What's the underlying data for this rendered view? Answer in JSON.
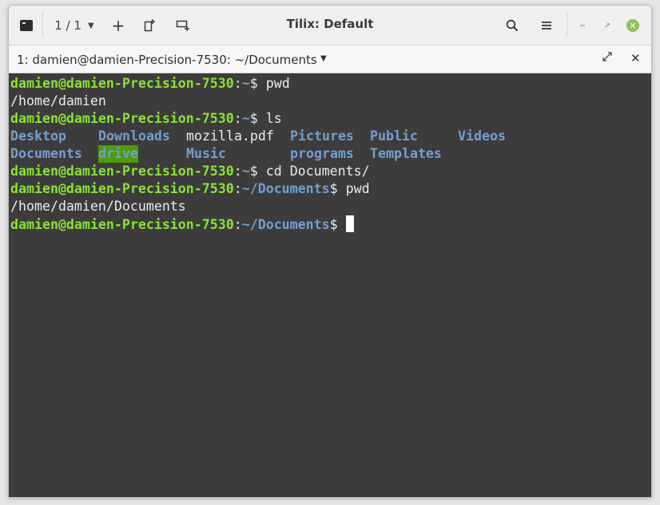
{
  "window": {
    "title": "Tilix: Default",
    "session_label": "1 / 1",
    "icons": {
      "app": "terminal-icon",
      "session_caret": "chevron-down-icon",
      "add_session": "plus-icon",
      "add_terminal_down": "add-terminal-down-icon",
      "add_terminal_right": "add-terminal-right-icon",
      "search": "search-icon",
      "menu": "hamburger-menu-icon",
      "minimize": "minimize-icon",
      "maximize": "maximize-icon",
      "close": "close-icon"
    }
  },
  "tab": {
    "title": "1: damien@damien-Precision-7530: ~/Documents",
    "icons": {
      "caret": "chevron-down-icon",
      "maximize": "maximize-icon",
      "close": "close-icon"
    }
  },
  "terminal": {
    "user_host": "damien@damien-Precision-7530",
    "colon": ":",
    "home": "~",
    "documents_path": "~/Documents",
    "dollar": "$ ",
    "commands": {
      "pwd": "pwd",
      "ls": "ls",
      "cd": "cd Documents/"
    },
    "outputs": {
      "pwd1": "/home/damien",
      "pwd2": "/home/damien/Documents"
    },
    "ls_row1": [
      "Desktop",
      "Downloads",
      "mozilla.pdf",
      "Pictures",
      "Public",
      "Videos"
    ],
    "ls_row2": [
      "Documents",
      "drive",
      "Music",
      "programs",
      "Templates"
    ],
    "colors": {
      "background": "#3c3c3c",
      "prompt": "#8ae234",
      "directory": "#729fcf",
      "text": "#ebebeb",
      "highlight_bg": "#4e9a06",
      "close_button": "#8fc15b"
    }
  }
}
